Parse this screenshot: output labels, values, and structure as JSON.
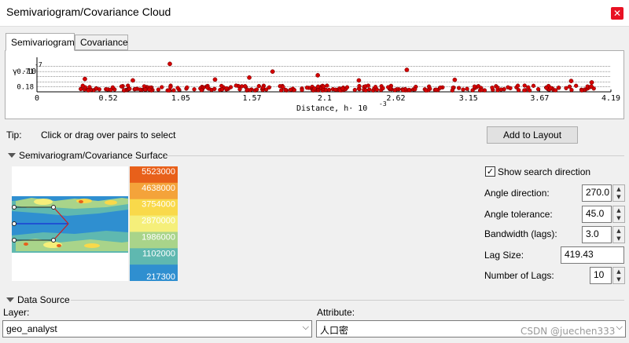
{
  "window": {
    "title": "Semivariogram/Covariance Cloud",
    "close_glyph": "✕"
  },
  "tabs": [
    {
      "label": "Semivariogram",
      "active": true
    },
    {
      "label": "Covariance",
      "active": false
    }
  ],
  "chart_data": {
    "type": "scatter",
    "ylabel": "γ ·10",
    "ylabel_exponent": "-7",
    "y_ticks": [
      "0.71",
      "0.18"
    ],
    "xlabel": "Distance, h· 10",
    "xlabel_exponent": "-3",
    "x_ticks": [
      "0",
      "0.52",
      "1.05",
      "1.57",
      "2.1",
      "2.62",
      "3.15",
      "3.67",
      "4.19"
    ],
    "xlim": [
      0,
      4.19
    ],
    "ylim": [
      0,
      1.1
    ],
    "point_color": "#d40000",
    "outliers": [
      {
        "x": 0.97,
        "y": 0.98
      },
      {
        "x": 1.55,
        "y": 0.5
      },
      {
        "x": 1.72,
        "y": 0.71
      },
      {
        "x": 2.05,
        "y": 0.58
      },
      {
        "x": 2.7,
        "y": 0.77
      },
      {
        "x": 1.3,
        "y": 0.43
      },
      {
        "x": 0.35,
        "y": 0.45
      },
      {
        "x": 3.05,
        "y": 0.42
      },
      {
        "x": 3.9,
        "y": 0.38
      },
      {
        "x": 4.05,
        "y": 0.33
      },
      {
        "x": 0.7,
        "y": 0.4
      },
      {
        "x": 2.35,
        "y": 0.4
      }
    ],
    "dense_band": {
      "x_range": [
        0.32,
        4.17
      ],
      "y_range": [
        0.05,
        0.22
      ],
      "count": 260
    }
  },
  "tip": {
    "label": "Tip:",
    "text": "Click or drag over pairs to select"
  },
  "add_to_layout_label": "Add to Layout",
  "surface_section": {
    "title": "Semivariogram/Covariance Surface"
  },
  "legend": {
    "labels": [
      "5523000",
      "4638000",
      "3754000",
      "2870000",
      "1986000",
      "1102000",
      "217300"
    ],
    "colors": [
      "#e8601a",
      "#f4a33a",
      "#f9d94a",
      "#f5ef7a",
      "#a9d48a",
      "#5fb8b0",
      "#2f8fd0"
    ]
  },
  "search": {
    "show_direction_label": "Show search direction",
    "show_direction_checked": true,
    "angle_direction_label": "Angle direction:",
    "angle_direction": "270.0",
    "angle_tolerance_label": "Angle tolerance:",
    "angle_tolerance": "45.0",
    "bandwidth_label": "Bandwidth (lags):",
    "bandwidth": "3.0",
    "lag_size_label": "Lag Size:",
    "lag_size": "419.43",
    "num_lags_label": "Number of Lags:",
    "num_lags": "10"
  },
  "data_source": {
    "title": "Data Source",
    "layer_label": "Layer:",
    "layer_value": "geo_analyst",
    "attribute_label": "Attribute:",
    "attribute_value": "人口密"
  },
  "watermark": "CSDN @juechen333"
}
